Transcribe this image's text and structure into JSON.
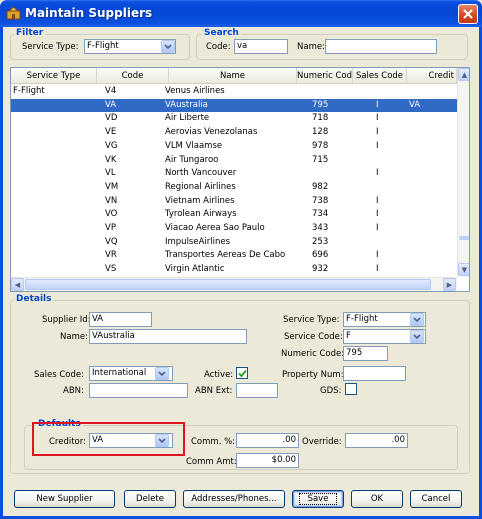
{
  "window": {
    "title": "Maintain Suppliers"
  },
  "filter": {
    "legend": "Filter",
    "service_type_label": "Service Type:",
    "service_type_value": "F-Flight"
  },
  "search": {
    "legend": "Search",
    "code_label": "Code:",
    "code_value": "va",
    "name_label": "Name:",
    "name_value": ""
  },
  "grid": {
    "columns": [
      "Service Type",
      "Code",
      "Name",
      "Numeric Code",
      "Sales Code",
      "Credit"
    ],
    "rows": [
      {
        "service_type": "F-Flight",
        "code": "V4",
        "name": "Venus Airlines",
        "numeric": "",
        "sales": "",
        "credit": ""
      },
      {
        "service_type": "",
        "code": "VA",
        "name": "VAustralia",
        "numeric": "795",
        "sales": "I",
        "credit": "VA"
      },
      {
        "service_type": "",
        "code": "VD",
        "name": "Air Liberte",
        "numeric": "718",
        "sales": "I",
        "credit": ""
      },
      {
        "service_type": "",
        "code": "VE",
        "name": "Aerovias Venezolanas",
        "numeric": "128",
        "sales": "I",
        "credit": ""
      },
      {
        "service_type": "",
        "code": "VG",
        "name": "VLM Vlaamse",
        "numeric": "978",
        "sales": "I",
        "credit": ""
      },
      {
        "service_type": "",
        "code": "VK",
        "name": "Air Tungaroo",
        "numeric": "715",
        "sales": "",
        "credit": ""
      },
      {
        "service_type": "",
        "code": "VL",
        "name": "North Vancouver",
        "numeric": "",
        "sales": "I",
        "credit": ""
      },
      {
        "service_type": "",
        "code": "VM",
        "name": "Regional Airlines",
        "numeric": "982",
        "sales": "",
        "credit": ""
      },
      {
        "service_type": "",
        "code": "VN",
        "name": "Vietnam Airlines",
        "numeric": "738",
        "sales": "I",
        "credit": ""
      },
      {
        "service_type": "",
        "code": "VO",
        "name": "Tyrolean Airways",
        "numeric": "734",
        "sales": "I",
        "credit": ""
      },
      {
        "service_type": "",
        "code": "VP",
        "name": "Viacao Aerea Sao Paulo",
        "numeric": "343",
        "sales": "I",
        "credit": ""
      },
      {
        "service_type": "",
        "code": "VQ",
        "name": "ImpulseAirlines",
        "numeric": "253",
        "sales": "",
        "credit": ""
      },
      {
        "service_type": "",
        "code": "VR",
        "name": "Transportes Aereas De Cabo",
        "numeric": "696",
        "sales": "I",
        "credit": ""
      },
      {
        "service_type": "",
        "code": "VS",
        "name": "Virgin Atlantic",
        "numeric": "932",
        "sales": "I",
        "credit": ""
      }
    ],
    "selected_index": 1,
    "scroll_up_glyph": "▲",
    "scroll_down_glyph": "▼",
    "scroll_left_glyph": "◀",
    "scroll_right_glyph": "▶"
  },
  "details": {
    "legend": "Details",
    "supplier_id_label": "Supplier Id:",
    "supplier_id_value": "VA",
    "name_label": "Name:",
    "name_value": "VAustralia",
    "service_type_label": "Service Type:",
    "service_type_value": "F-Flight",
    "service_code_label": "Service Code:",
    "service_code_value": "F",
    "numeric_code_label": "Numeric Code:",
    "numeric_code_value": "795",
    "sales_code_label": "Sales Code:",
    "sales_code_value": "International",
    "active_label": "Active:",
    "active_checked": true,
    "property_num_label": "Property Num:",
    "property_num_value": "",
    "abn_label": "ABN:",
    "abn_value": "",
    "abn_ext_label": "ABN Ext:",
    "abn_ext_value": "",
    "gds_label": "GDS:",
    "gds_checked": false
  },
  "defaults": {
    "legend": "Defaults",
    "creditor_label": "Creditor:",
    "creditor_value": "VA",
    "comm_pct_label": "Comm. %:",
    "comm_pct_value": ".00",
    "override_label": "Override:",
    "override_value": ".00",
    "comm_amt_label": "Comm Amt:",
    "comm_amt_value": "$0.00"
  },
  "buttons": {
    "new_supplier": "New Supplier",
    "delete": "Delete",
    "addresses": "Addresses/Phones...",
    "save": "Save",
    "ok": "OK",
    "cancel": "Cancel"
  },
  "colors": {
    "selection": "#316ac5",
    "highlight_box": "#e0141e",
    "legend": "#0046d5",
    "titlebar": "#0646d6"
  },
  "icons": {
    "app": "app-icon",
    "close": "close-icon",
    "combo": "chevron-down-icon",
    "check": "checkmark-icon"
  }
}
